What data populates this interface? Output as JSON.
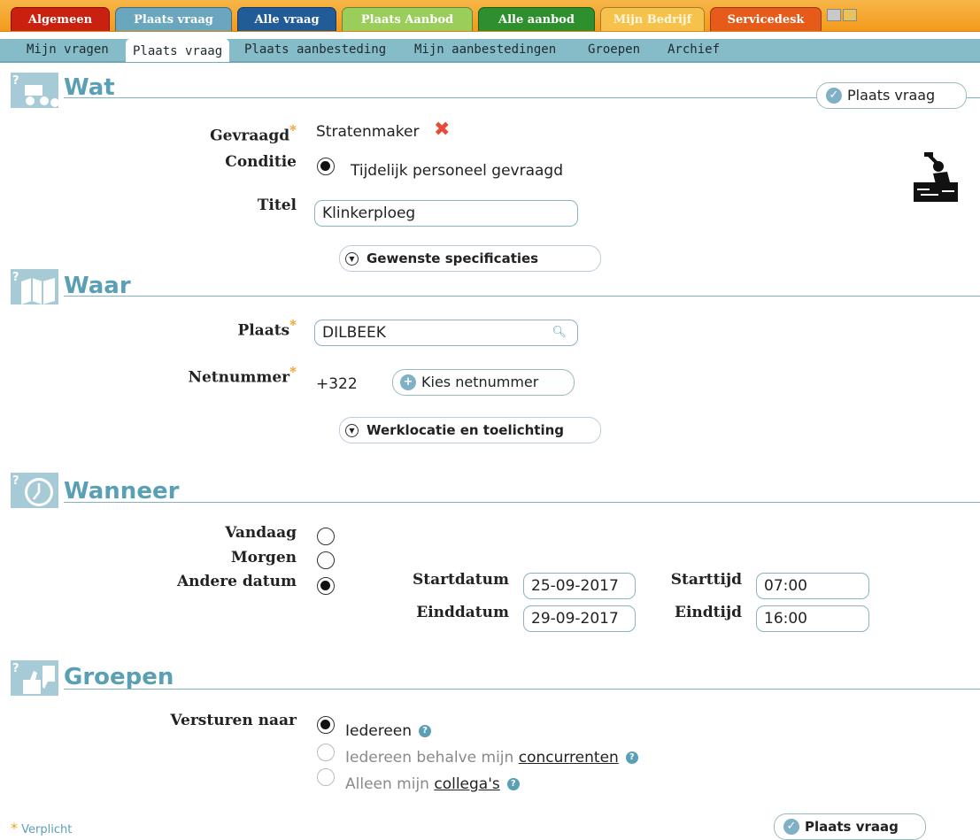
{
  "top_tabs": [
    {
      "label": "Algemeen",
      "color": "#c9200f"
    },
    {
      "label": "Plaats vraag",
      "color": "#6aa7bf"
    },
    {
      "label": "Alle vraag",
      "color": "#215c99"
    },
    {
      "label": "Plaats Aanbod",
      "color": "#9bcd5a"
    },
    {
      "label": "Alle aanbod",
      "color": "#2e8f2e"
    },
    {
      "label": "Mijn Bedrijf",
      "color": "#f6c24b"
    },
    {
      "label": "Servicedesk",
      "color": "#e65a1a"
    }
  ],
  "sub_nav": [
    "Mijn vragen",
    "Plaats vraag",
    "Plaats aanbesteding",
    "Mijn aanbestedingen",
    "Groepen",
    "Archief"
  ],
  "sections": {
    "wat": "Wat",
    "waar": "Waar",
    "wanneer": "Wanneer",
    "groepen": "Groepen"
  },
  "wat": {
    "gevraagd_label": "Gevraagd",
    "gevraagd_value": "Stratenmaker",
    "conditie_label": "Conditie",
    "conditie_value": "Tijdelijk personeel gevraagd",
    "titel_label": "Titel",
    "titel_value": "Klinkerploeg",
    "specs_label": "Gewenste specificaties"
  },
  "waar": {
    "plaats_label": "Plaats",
    "plaats_value": "DILBEEK",
    "netnummer_label": "Netnummer",
    "netnummer_value": "+322",
    "kies_label": "Kies netnummer",
    "werklocatie_label": "Werklocatie en toelichting"
  },
  "wanneer": {
    "vandaag": "Vandaag",
    "morgen": "Morgen",
    "andere": "Andere datum",
    "startdatum_label": "Startdatum",
    "startdatum_value": "25-09-2017",
    "einddatum_label": "Einddatum",
    "einddatum_value": "29-09-2017",
    "starttijd_label": "Starttijd",
    "starttijd_value": "07:00",
    "eindtijd_label": "Eindtijd",
    "eindtijd_value": "16:00"
  },
  "groepen": {
    "versturen_label": "Versturen naar",
    "opt1": "Iedereen",
    "opt2_prefix": "Iedereen behalve mijn ",
    "opt2_link": "concurrenten",
    "opt3_prefix": "Alleen mijn ",
    "opt3_link": "collega's"
  },
  "buttons": {
    "plaats_vraag": "Plaats vraag"
  },
  "footer": {
    "verplicht": "Verplicht"
  }
}
